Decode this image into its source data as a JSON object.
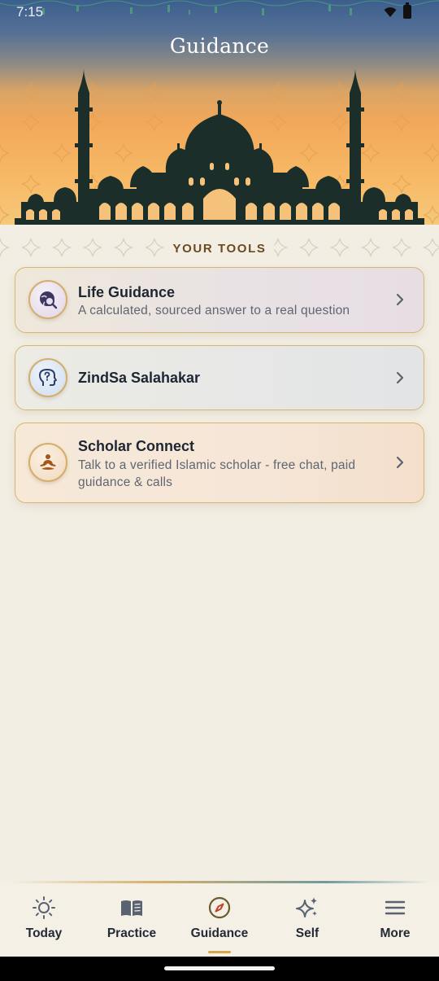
{
  "status_bar": {
    "time": "7:15"
  },
  "header": {
    "title": "Guidance"
  },
  "section": {
    "title": "YOUR TOOLS"
  },
  "tools": [
    {
      "title": "Life Guidance",
      "description": "A calculated, sourced answer to a real question",
      "icon": "globe-search-icon"
    },
    {
      "title": "ZindSa Salahakar",
      "description": "",
      "icon": "head-question-icon"
    },
    {
      "title": "Scholar Connect",
      "description": "Talk to a verified Islamic scholar - free chat, paid guidance & calls",
      "icon": "meditating-scholar-icon"
    }
  ],
  "nav": {
    "items": [
      {
        "label": "Today",
        "icon": "sun-icon"
      },
      {
        "label": "Practice",
        "icon": "book-icon"
      },
      {
        "label": "Guidance",
        "icon": "compass-icon",
        "active": true
      },
      {
        "label": "Self",
        "icon": "sparkles-icon"
      },
      {
        "label": "More",
        "icon": "menu-icon"
      }
    ]
  },
  "colors": {
    "background": "#F2EEE3",
    "accent_gold": "#D6A74A",
    "card_border": "#D9B46E",
    "header_top": "#3C5F8E",
    "header_bottom": "#F5C87A",
    "silhouette": "#1B2E29"
  }
}
